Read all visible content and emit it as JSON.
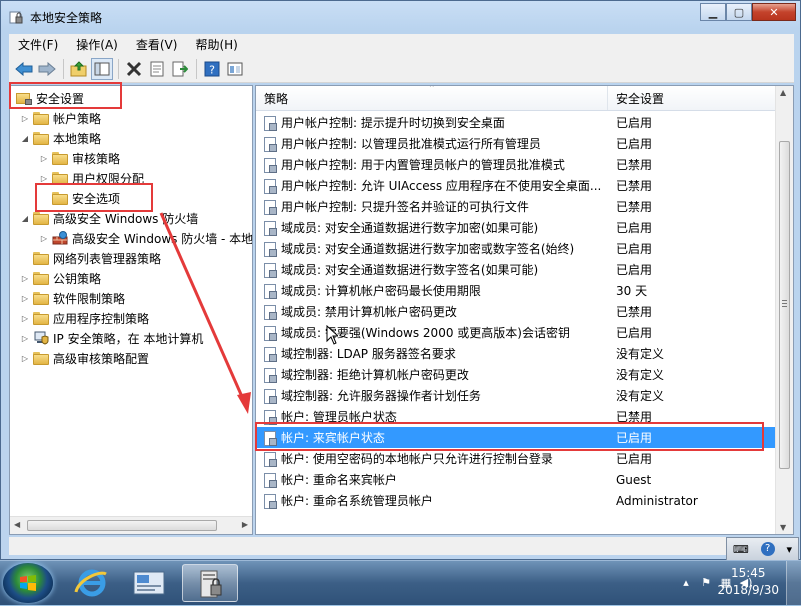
{
  "window": {
    "title": "本地安全策略",
    "buttons": [
      "minimize",
      "maximize",
      "close"
    ]
  },
  "menu": [
    "文件(F)",
    "操作(A)",
    "查看(V)",
    "帮助(H)"
  ],
  "toolbar_icons": [
    "back-icon",
    "forward-icon",
    "up-folder-icon",
    "show-hide-tree-icon",
    "delete-icon",
    "properties-icon",
    "export-list-icon",
    "help-icon",
    "view-icon"
  ],
  "tree": {
    "root": "安全设置",
    "items": [
      {
        "label": "帐户策略",
        "level": 1,
        "expanded": false
      },
      {
        "label": "本地策略",
        "level": 1,
        "expanded": true
      },
      {
        "label": "审核策略",
        "level": 2,
        "expanded": false
      },
      {
        "label": "用户权限分配",
        "level": 2,
        "expanded": false
      },
      {
        "label": "安全选项",
        "level": 2,
        "selected": true
      },
      {
        "label": "高级安全 Windows 防火墙",
        "level": 1,
        "expanded": true
      },
      {
        "label": "高级安全 Windows 防火墙 - 本地",
        "level": 2,
        "expanded": false
      },
      {
        "label": "网络列表管理器策略",
        "level": 1
      },
      {
        "label": "公钥策略",
        "level": 1,
        "expanded": false
      },
      {
        "label": "软件限制策略",
        "level": 1,
        "expanded": false
      },
      {
        "label": "应用程序控制策略",
        "level": 1,
        "expanded": false
      },
      {
        "label": "IP 安全策略，在 本地计算机",
        "level": 1,
        "expanded": false
      },
      {
        "label": "高级审核策略配置",
        "level": 1,
        "expanded": false
      }
    ]
  },
  "list": {
    "columns": [
      "策略",
      "安全设置"
    ],
    "rows": [
      {
        "policy": "用户帐户控制: 提示提升时切换到安全桌面",
        "setting": "已启用"
      },
      {
        "policy": "用户帐户控制: 以管理员批准模式运行所有管理员",
        "setting": "已启用"
      },
      {
        "policy": "用户帐户控制: 用于内置管理员帐户的管理员批准模式",
        "setting": "已禁用"
      },
      {
        "policy": "用户帐户控制: 允许 UIAccess 应用程序在不使用安全桌面...",
        "setting": "已禁用"
      },
      {
        "policy": "用户帐户控制: 只提升签名并验证的可执行文件",
        "setting": "已禁用"
      },
      {
        "policy": "域成员: 对安全通道数据进行数字加密(如果可能)",
        "setting": "已启用"
      },
      {
        "policy": "域成员: 对安全通道数据进行数字加密或数字签名(始终)",
        "setting": "已启用"
      },
      {
        "policy": "域成员: 对安全通道数据进行数字签名(如果可能)",
        "setting": "已启用"
      },
      {
        "policy": "域成员: 计算机帐户密码最长使用期限",
        "setting": "30 天"
      },
      {
        "policy": "域成员: 禁用计算机帐户密码更改",
        "setting": "已禁用"
      },
      {
        "policy": "域成员: 需要强(Windows 2000 或更高版本)会话密钥",
        "setting": "已启用"
      },
      {
        "policy": "域控制器: LDAP 服务器签名要求",
        "setting": "没有定义"
      },
      {
        "policy": "域控制器: 拒绝计算机帐户密码更改",
        "setting": "没有定义"
      },
      {
        "policy": "域控制器: 允许服务器操作者计划任务",
        "setting": "没有定义"
      },
      {
        "policy": "帐户: 管理员帐户状态",
        "setting": "已禁用"
      },
      {
        "policy": "帐户: 来宾帐户状态",
        "setting": "已启用",
        "selected": true
      },
      {
        "policy": "帐户: 使用空密码的本地帐户只允许进行控制台登录",
        "setting": "已启用"
      },
      {
        "policy": "帐户: 重命名来宾帐户",
        "setting": "Guest"
      },
      {
        "policy": "帐户: 重命名系统管理员帐户",
        "setting": "Administrator"
      }
    ]
  },
  "taskbar": {
    "apps": [
      "internet-explorer-icon",
      "server-manager-icon",
      "local-security-policy-icon"
    ],
    "tray_icons": [
      "arrow-up-icon",
      "flag-icon",
      "network-icon",
      "volume-icon"
    ],
    "time": "15:45",
    "date": "2018/9/30"
  },
  "colors": {
    "highlight": "#e43a3a",
    "selection": "#3399ff"
  }
}
